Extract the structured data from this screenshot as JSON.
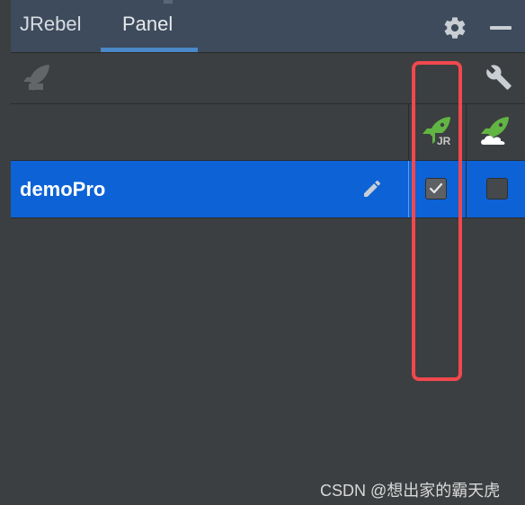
{
  "header": {
    "tabs": [
      {
        "label": "JRebel",
        "active": false
      },
      {
        "label": "Panel",
        "active": true
      }
    ],
    "icons": [
      "gear-icon",
      "minimize-icon"
    ]
  },
  "toolbar": {
    "icons": [
      "rocket-icon",
      "wrench-icon"
    ]
  },
  "table": {
    "column_icons": [
      "jrebel-rocket-icon",
      "cloud-rocket-icon"
    ],
    "rows": [
      {
        "name": "demoPro",
        "jrebel_enabled": true,
        "remote_enabled": false
      }
    ]
  },
  "watermark": "CSDN @想出家的霸天虎",
  "colors": {
    "titlebar": "#3d4b5c",
    "selected_row": "#0d62d6",
    "accent_underline": "#4a88c7",
    "highlight": "#f0484d",
    "rocket_green": "#62b543"
  }
}
